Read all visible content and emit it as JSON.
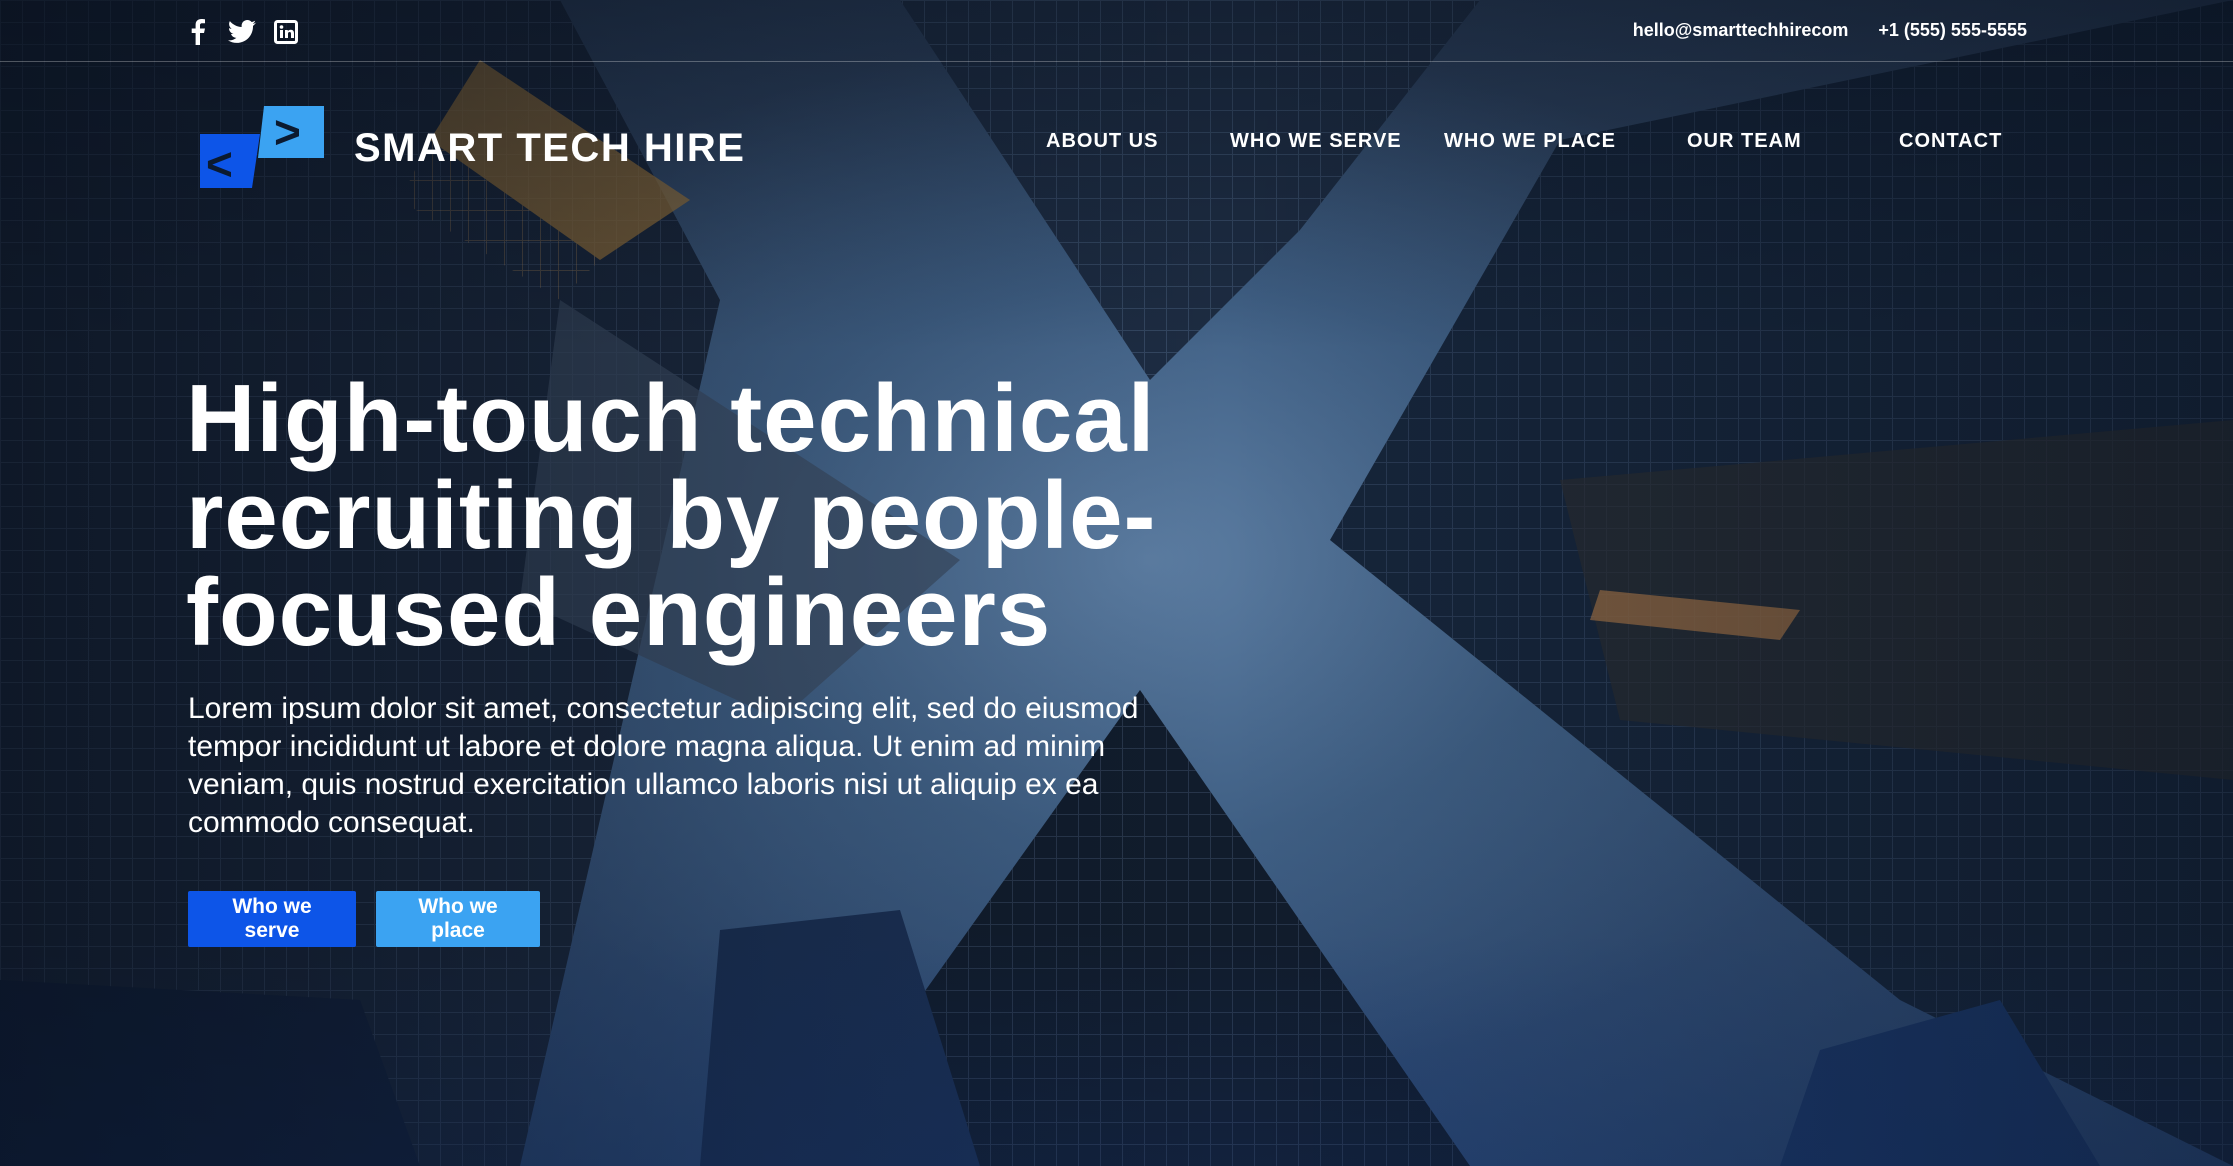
{
  "colors": {
    "primary": "#0d55e8",
    "secondary": "#3ba3f2",
    "text": "#ffffff"
  },
  "social": [
    {
      "name": "facebook-icon"
    },
    {
      "name": "twitter-icon"
    },
    {
      "name": "linkedin-icon"
    }
  ],
  "contact": {
    "email": "hello@smarttechhirecom",
    "phone": "+1 (555) 555-5555"
  },
  "brand": {
    "name": "SMART TECH HIRE",
    "logo_left_glyph": "<",
    "logo_right_glyph": ">"
  },
  "nav": {
    "items": [
      {
        "label": "ABOUT US"
      },
      {
        "label": "WHO WE SERVE"
      },
      {
        "label": "WHO WE PLACE"
      },
      {
        "label": "OUR TEAM"
      },
      {
        "label": "CONTACT"
      }
    ]
  },
  "hero": {
    "headline": "High-touch technical recruiting by people-focused engineers",
    "body": "Lorem ipsum dolor sit amet, consectetur adipiscing elit, sed do eiusmod tempor incididunt ut labore et dolore magna aliqua. Ut enim ad minim veniam, quis nostrud exercitation ullamco laboris nisi ut aliquip ex ea commodo consequat.",
    "primary_button": "Who we serve",
    "secondary_button": "Who we place"
  }
}
